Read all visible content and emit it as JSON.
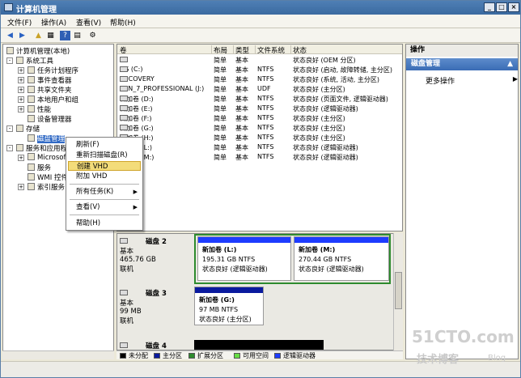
{
  "title": "计算机管理",
  "menu": [
    "文件(F)",
    "操作(A)",
    "查看(V)",
    "帮助(H)"
  ],
  "tree": {
    "root": "计算机管理(本地)",
    "system_tools": "系统工具",
    "task_scheduler": "任务计划程序",
    "event_viewer": "事件查看器",
    "shared_folders": "共享文件夹",
    "local_users": "本地用户和组",
    "performance": "性能",
    "device_manager": "设备管理器",
    "storage": "存储",
    "disk_management": "磁盘管理",
    "services_apps": "服务和应用程",
    "microsoft": "Microsof",
    "services": "服务",
    "wmi": "WMI 控件",
    "indexing": "索引服务"
  },
  "list": {
    "headers": [
      "卷",
      "布局",
      "类型",
      "文件系统",
      "状态"
    ],
    "rows": [
      {
        "vol": "",
        "layout": "简单",
        "type": "基本",
        "fs": "",
        "status": "状态良好 (OEM 分区)"
      },
      {
        "vol": "OS (C:)",
        "layout": "简单",
        "type": "基本",
        "fs": "NTFS",
        "status": "状态良好 (启动, 故障转储, 主分区)"
      },
      {
        "vol": "RECOVERY",
        "layout": "简单",
        "type": "基本",
        "fs": "NTFS",
        "status": "状态良好 (系统, 活动, 主分区)"
      },
      {
        "vol": "WIN_7_PROFESSIONAL (J:)",
        "layout": "简单",
        "type": "基本",
        "fs": "UDF",
        "status": "状态良好 (主分区)"
      },
      {
        "vol": "新加卷 (D:)",
        "layout": "简单",
        "type": "基本",
        "fs": "NTFS",
        "status": "状态良好 (页面文件, 逻辑驱动器)"
      },
      {
        "vol": "新加卷 (E:)",
        "layout": "简单",
        "type": "基本",
        "fs": "NTFS",
        "status": "状态良好 (逻辑驱动器)"
      },
      {
        "vol": "新加卷 (F:)",
        "layout": "简单",
        "type": "基本",
        "fs": "NTFS",
        "status": "状态良好 (主分区)"
      },
      {
        "vol": "新加卷 (G:)",
        "layout": "简单",
        "type": "基本",
        "fs": "NTFS",
        "status": "状态良好 (主分区)"
      },
      {
        "vol": "新加卷 (H:)",
        "layout": "简单",
        "type": "基本",
        "fs": "NTFS",
        "status": "状态良好 (主分区)"
      },
      {
        "vol": "新加卷 (L:)",
        "layout": "简单",
        "type": "基本",
        "fs": "NTFS",
        "status": "状态良好 (逻辑驱动器)"
      },
      {
        "vol": "新加卷 (M:)",
        "layout": "简单",
        "type": "基本",
        "fs": "NTFS",
        "status": "状态良好 (逻辑驱动器)"
      }
    ]
  },
  "disks": [
    {
      "name": "磁盘 2",
      "type": "基本",
      "size": "465.76 GB",
      "state": "联机",
      "partitions": [
        {
          "name": "新加卷 (L:)",
          "detail": "195.31 GB NTFS",
          "status": "状态良好 (逻辑驱动器)"
        },
        {
          "name": "新加卷 (M:)",
          "detail": "270.44 GB NTFS",
          "status": "状态良好 (逻辑驱动器)"
        }
      ]
    },
    {
      "name": "磁盘 3",
      "type": "基本",
      "size": "99 MB",
      "state": "联机",
      "partitions": [
        {
          "name": "新加卷 (G:)",
          "detail": "97 MB NTFS",
          "status": "状态良好 (主分区)"
        }
      ]
    },
    {
      "name": "磁盘 4"
    }
  ],
  "legend": [
    {
      "label": "未分配",
      "color": "#000000"
    },
    {
      "label": "主分区",
      "color": "#0a1a9e"
    },
    {
      "label": "扩展分区",
      "color": "#2e8b2e"
    },
    {
      "label": "可用空间",
      "color": "#66dd44"
    },
    {
      "label": "逻辑驱动器",
      "color": "#1e3cff"
    }
  ],
  "actions": {
    "header": "操作",
    "section": "磁盘管理",
    "more": "更多操作"
  },
  "context_menu": {
    "refresh": "刷新(F)",
    "rescan": "重新扫描磁盘(R)",
    "create_vhd": "创建 VHD",
    "attach_vhd": "附加 VHD",
    "all_tasks": "所有任务(K)",
    "view": "查看(V)",
    "help": "帮助(H)"
  },
  "watermark": {
    "site": "51CTO.com",
    "tagline": "技术博客",
    "blog": "Blog"
  },
  "colors": {
    "accent": "#316ac5",
    "primary_partition": "#0a1a9e",
    "logical_selected_border": "#2e8b2e",
    "highlight": "#f3dc7a"
  }
}
